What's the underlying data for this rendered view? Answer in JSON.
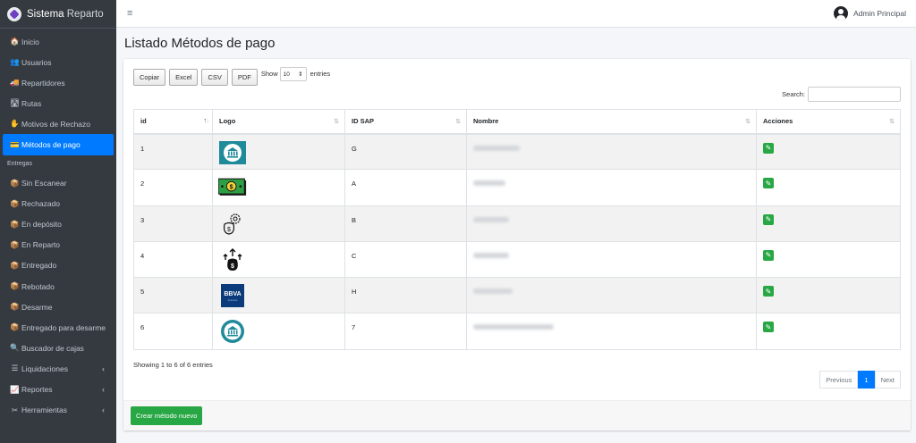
{
  "brand": {
    "bold": "Sistema",
    "light": "Reparto"
  },
  "topbar": {
    "menu_glyph": "≡",
    "user_name": "Admin Principal"
  },
  "sidebar": {
    "items": [
      {
        "label": "Inicio",
        "icon": "🏠"
      },
      {
        "label": "Usuarios",
        "icon": "👥"
      },
      {
        "label": "Repartidores",
        "icon": "🚚"
      },
      {
        "label": "Rutas",
        "icon": "🛣"
      },
      {
        "label": "Motivos de Rechazo",
        "icon": "✋"
      },
      {
        "label": "Métodos de pago",
        "icon": "💳"
      }
    ],
    "section_header": "Entregas",
    "entregas": [
      {
        "label": "Sin Escanear",
        "icon": "📦"
      },
      {
        "label": "Rechazado",
        "icon": "📦"
      },
      {
        "label": "En depósito",
        "icon": "📦"
      },
      {
        "label": "En Reparto",
        "icon": "📦"
      },
      {
        "label": "Entregado",
        "icon": "📦"
      },
      {
        "label": "Rebotado",
        "icon": "📦"
      },
      {
        "label": "Desarme",
        "icon": "📦"
      },
      {
        "label": "Entregado para desarme",
        "icon": "📦"
      },
      {
        "label": "Buscador de cajas",
        "icon": "🔍"
      },
      {
        "label": "Liquidaciones",
        "icon": "☰",
        "chev": "‹"
      },
      {
        "label": "Reportes",
        "icon": "📈",
        "chev": "‹"
      },
      {
        "label": "Herramientas",
        "icon": "✂",
        "chev": "‹"
      }
    ]
  },
  "page": {
    "title": "Listado Métodos de pago"
  },
  "toolbar": {
    "buttons": [
      "Copiar",
      "Excel",
      "CSV",
      "PDF"
    ],
    "show_label": "Show",
    "page_length": "10",
    "entries_label": "entries",
    "search_label": "Search:"
  },
  "table": {
    "headers": [
      "id",
      "Logo",
      "ID SAP",
      "Nombre",
      "Acciones"
    ],
    "sort_icons": {
      "active": "↑",
      "neutral": "⇅"
    },
    "rows": [
      {
        "id": "1",
        "logo": "bank-circle-icon",
        "sap": "G"
      },
      {
        "id": "2",
        "logo": "cash-bill-icon",
        "sap": "A"
      },
      {
        "id": "3",
        "logo": "money-bag-gear-icon",
        "sap": "B"
      },
      {
        "id": "4",
        "logo": "money-bag-arrows-icon",
        "sap": "C"
      },
      {
        "id": "5",
        "logo": "bbva-logo",
        "sap": "H"
      },
      {
        "id": "6",
        "logo": "bank-round-icon",
        "sap": "7"
      }
    ],
    "edit_glyph": "✎"
  },
  "footer": {
    "info": "Showing 1 to 6 of 6 entries",
    "prev": "Previous",
    "current": "1",
    "next": "Next",
    "create_button": "Crear método nuevo"
  },
  "colors": {
    "sidebar_bg": "#343a40",
    "active": "#007bff",
    "success": "#28a745"
  }
}
